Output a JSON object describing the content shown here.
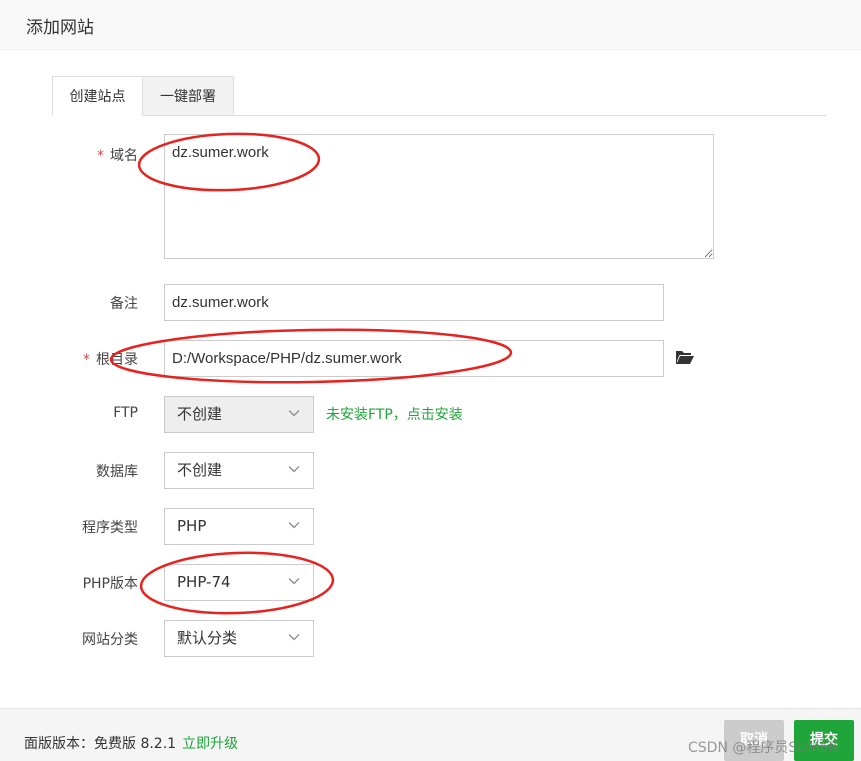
{
  "dialog": {
    "title": "添加网站"
  },
  "tabs": [
    {
      "label": "创建站点",
      "active": true
    },
    {
      "label": "一键部署",
      "active": false
    }
  ],
  "form": {
    "required_mark": "*",
    "domain": {
      "label": "域名",
      "value": "dz.sumer.work"
    },
    "remark": {
      "label": "备注",
      "value": "dz.sumer.work"
    },
    "root": {
      "label": "根目录",
      "value": "D:/Workspace/PHP/dz.sumer.work",
      "icon": "folder-open-icon"
    },
    "ftp": {
      "label": "FTP",
      "selected": "不创建",
      "install_link": "未安装FTP，点击安装"
    },
    "database": {
      "label": "数据库",
      "selected": "不创建"
    },
    "program_type": {
      "label": "程序类型",
      "selected": "PHP"
    },
    "php_version": {
      "label": "PHP版本",
      "selected": "PHP-74"
    },
    "site_category": {
      "label": "网站分类",
      "selected": "默认分类"
    }
  },
  "footer": {
    "version_text": "面版版本：免费版 8.2.1",
    "upgrade_link": "立即升级",
    "cancel_label": "取消",
    "submit_label": "提交"
  },
  "watermark": "CSDN @程序员SUMER",
  "colors": {
    "accent_green": "#20a53a",
    "required_red": "#e64340",
    "annotation_red": "#e8231f"
  }
}
